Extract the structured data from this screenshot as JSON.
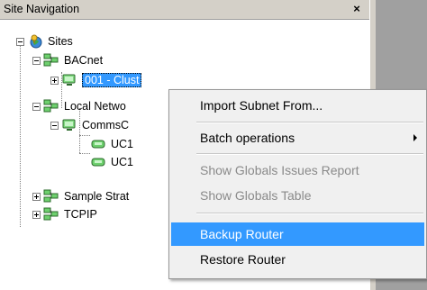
{
  "panel": {
    "title": "Site Navigation",
    "close_label": "×"
  },
  "tree": {
    "sites": "Sites",
    "bacnet": "BACnet",
    "cluster": "001 - Clust",
    "local_network": "Local Netwo",
    "comms": "CommsC",
    "uc1": "UC1",
    "uc2": "UC1",
    "sample_strat": "Sample Strat",
    "tcpip": "TCPIP"
  },
  "context_menu": {
    "items": [
      {
        "label": "Import Subnet From...",
        "enabled": true
      },
      {
        "label": "Batch operations",
        "enabled": true,
        "submenu": true
      },
      {
        "label": "Show Globals Issues Report",
        "enabled": false
      },
      {
        "label": "Show Globals Table",
        "enabled": false
      },
      {
        "label": "Backup Router",
        "enabled": true,
        "highlighted": true
      },
      {
        "label": "Restore Router",
        "enabled": true
      }
    ]
  },
  "colors": {
    "highlight": "#3399ff",
    "menu_bg": "#f0f0f0",
    "titlebar_bg": "#d4d0c8"
  },
  "icons": {
    "sites": "globe-pin-icon",
    "network": "network-computers-icon",
    "device": "monitor-icon"
  }
}
